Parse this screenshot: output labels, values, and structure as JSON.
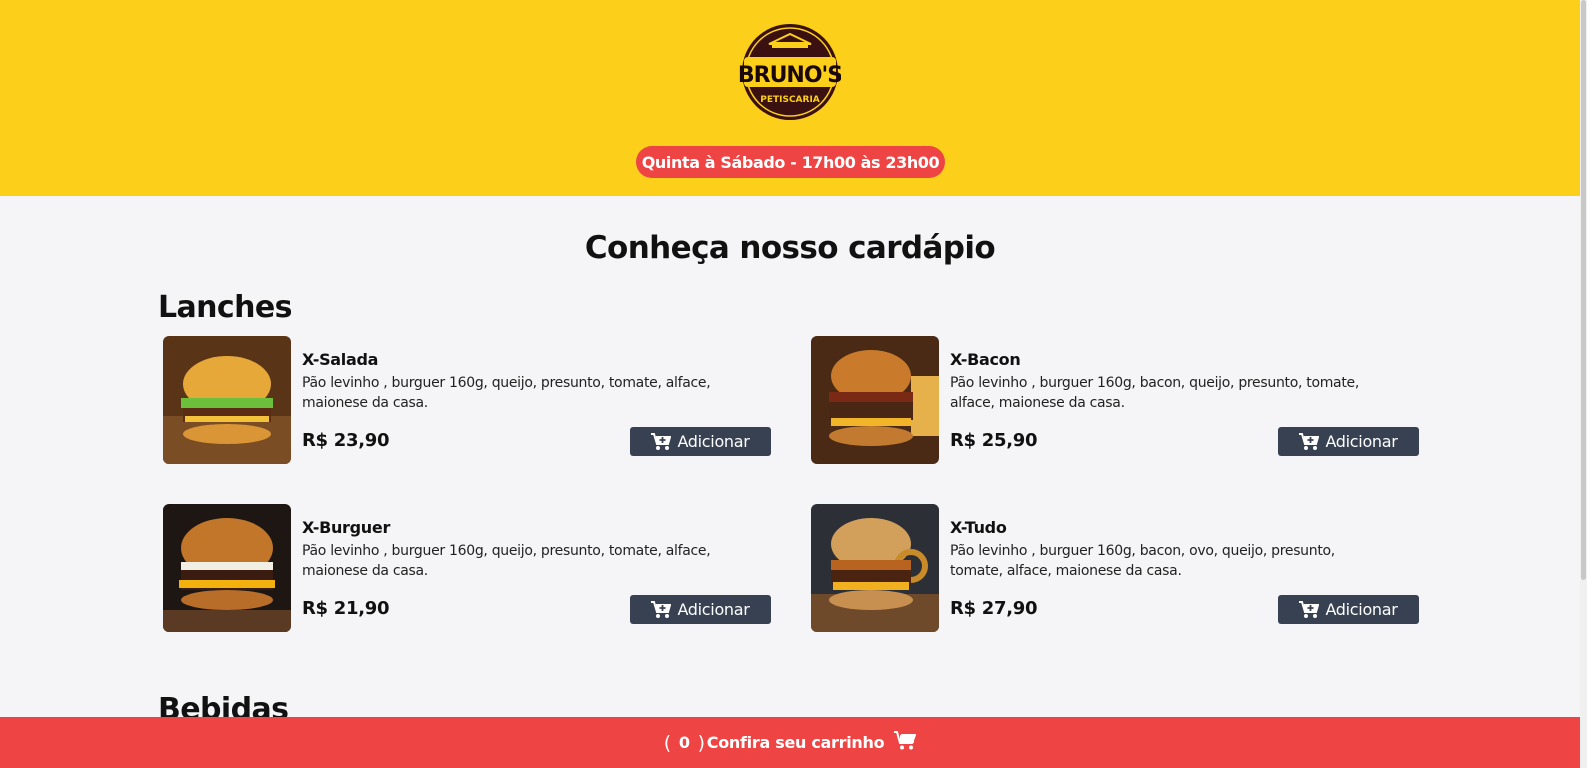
{
  "header": {
    "logo_text": "BRUNO'S",
    "logo_subtext": "PETISCARIA",
    "hours": "Quinta à Sábado - 17h00 às 23h00"
  },
  "main": {
    "title": "Conheça nosso cardápio",
    "sections": [
      {
        "title": "Lanches",
        "items": [
          {
            "name": "X-Salada",
            "description": "Pão levinho , burguer 160g, queijo, presunto, tomate, alface, maionese da casa.",
            "price": "R$ 23,90",
            "button": "Adicionar"
          },
          {
            "name": "X-Bacon",
            "description": "Pão levinho , burguer 160g, bacon, queijo, presunto, tomate, alface, maionese da casa.",
            "price": "R$ 25,90",
            "button": "Adicionar"
          },
          {
            "name": "X-Burguer",
            "description": "Pão levinho , burguer 160g, queijo, presunto, tomate, alface, maionese da casa.",
            "price": "R$ 21,90",
            "button": "Adicionar"
          },
          {
            "name": "X-Tudo",
            "description": "Pão levinho , burguer 160g, bacon, ovo, queijo, presunto, tomate, alface, maionese da casa.",
            "price": "R$ 27,90",
            "button": "Adicionar"
          }
        ]
      },
      {
        "title": "Bebidas"
      }
    ]
  },
  "cart": {
    "open_paren": "(",
    "count": "0",
    "close_paren": ")",
    "label": "Confira seu carrinho"
  },
  "colors": {
    "header_bg": "#fccf1a",
    "accent_red": "#ef4444",
    "button_dark": "#374151",
    "page_bg": "#f5f5f8"
  },
  "icons": [
    "cart-plus-icon",
    "shopping-cart-icon"
  ]
}
